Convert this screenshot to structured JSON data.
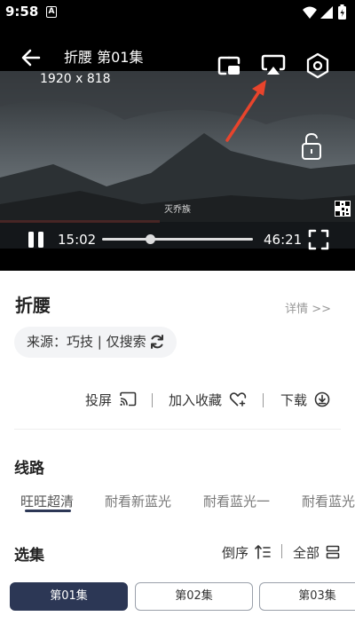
{
  "status_bar": {
    "time": "9:58",
    "notification_letter": "A"
  },
  "player": {
    "title": "折腰 第01集",
    "resolution": "1920 x 818",
    "watermark": "灭乔族",
    "current_time": "15:02",
    "total_time": "46:21",
    "progress": 0.32,
    "icons": [
      "back-arrow-icon",
      "pip-icon",
      "cast-icon",
      "settings-hexagon-icon",
      "unlock-icon",
      "qr-code-icon",
      "pause-icon",
      "fullscreen-icon"
    ]
  },
  "info": {
    "title": "折腰",
    "details_link": "详情 >>",
    "source_label": "来源：巧技 | 仅搜索"
  },
  "actions": {
    "cast_label": "投屏",
    "favorite_label": "加入收藏",
    "download_label": "下载"
  },
  "lines": {
    "section_title": "线路",
    "tabs": [
      "旺旺超清",
      "耐看新蓝光",
      "耐看蓝光一",
      "耐看蓝光"
    ]
  },
  "episodes": {
    "section_title": "选集",
    "sort_label": "倒序",
    "all_label": "全部",
    "items": [
      "第01集",
      "第02集",
      "第03集"
    ],
    "active_index": 0
  },
  "colors": {
    "accent": "#2c3755",
    "arrow": "#e8442c"
  }
}
